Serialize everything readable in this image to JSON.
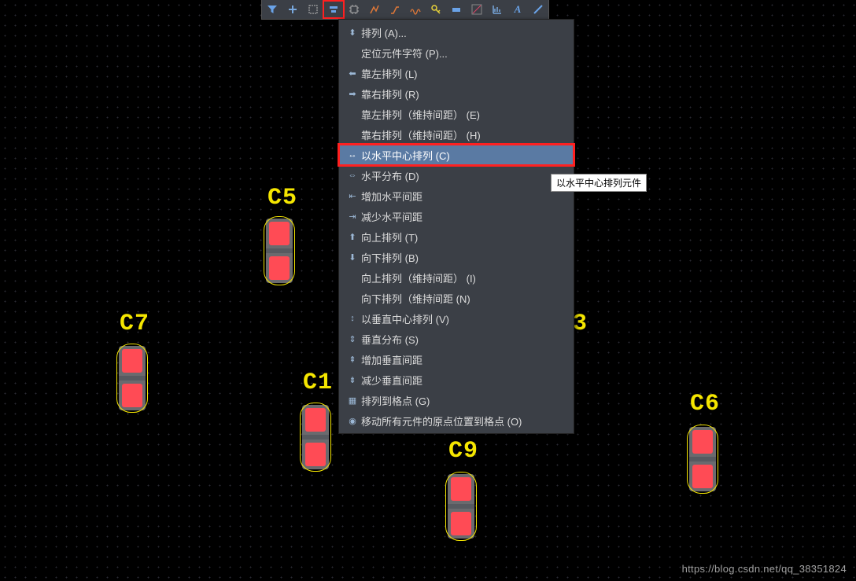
{
  "toolbar_icons": [
    "filter",
    "plus",
    "select-box",
    "align",
    "chip",
    "segment",
    "route",
    "wave",
    "key",
    "pad",
    "trace",
    "text",
    "line"
  ],
  "menu": [
    {
      "icon": "⬍",
      "label": "排列 (A)..."
    },
    {
      "icon": "",
      "label": "定位元件字符 (P)..."
    },
    {
      "icon": "⬅",
      "label": "靠左排列 (L)"
    },
    {
      "icon": "➡",
      "label": "靠右排列 (R)"
    },
    {
      "icon": "",
      "label": "靠左排列（维持间距） (E)"
    },
    {
      "icon": "",
      "label": "靠右排列（维持间距） (H)"
    },
    {
      "icon": "↔",
      "label": "以水平中心排列 (C)"
    },
    {
      "icon": "⇔",
      "label": "水平分布 (D)"
    },
    {
      "icon": "⇤",
      "label": "增加水平间距"
    },
    {
      "icon": "⇥",
      "label": "减少水平间距"
    },
    {
      "icon": "⬆",
      "label": "向上排列 (T)"
    },
    {
      "icon": "⬇",
      "label": "向下排列 (B)"
    },
    {
      "icon": "",
      "label": "向上排列（维持间距） (I)"
    },
    {
      "icon": "",
      "label": "向下排列（维持间距 (N)"
    },
    {
      "icon": "↕",
      "label": "以垂直中心排列 (V)"
    },
    {
      "icon": "⇕",
      "label": "垂直分布 (S)"
    },
    {
      "icon": "⇞",
      "label": "增加垂直间距"
    },
    {
      "icon": "⇟",
      "label": "减少垂直间距"
    },
    {
      "icon": "▦",
      "label": "排列到格点 (G)"
    },
    {
      "icon": "◉",
      "label": "移动所有元件的原点位置到格点 (O)"
    }
  ],
  "tooltip": "以水平中心排列元件",
  "components": {
    "c5": {
      "ref": "C5"
    },
    "c7": {
      "ref": "C7"
    },
    "c1": {
      "ref": "C1"
    },
    "c9": {
      "ref": "C9"
    },
    "c6": {
      "ref": "C6"
    },
    "c8_frag": "3"
  },
  "watermark": "https://blog.csdn.net/qq_38351824"
}
